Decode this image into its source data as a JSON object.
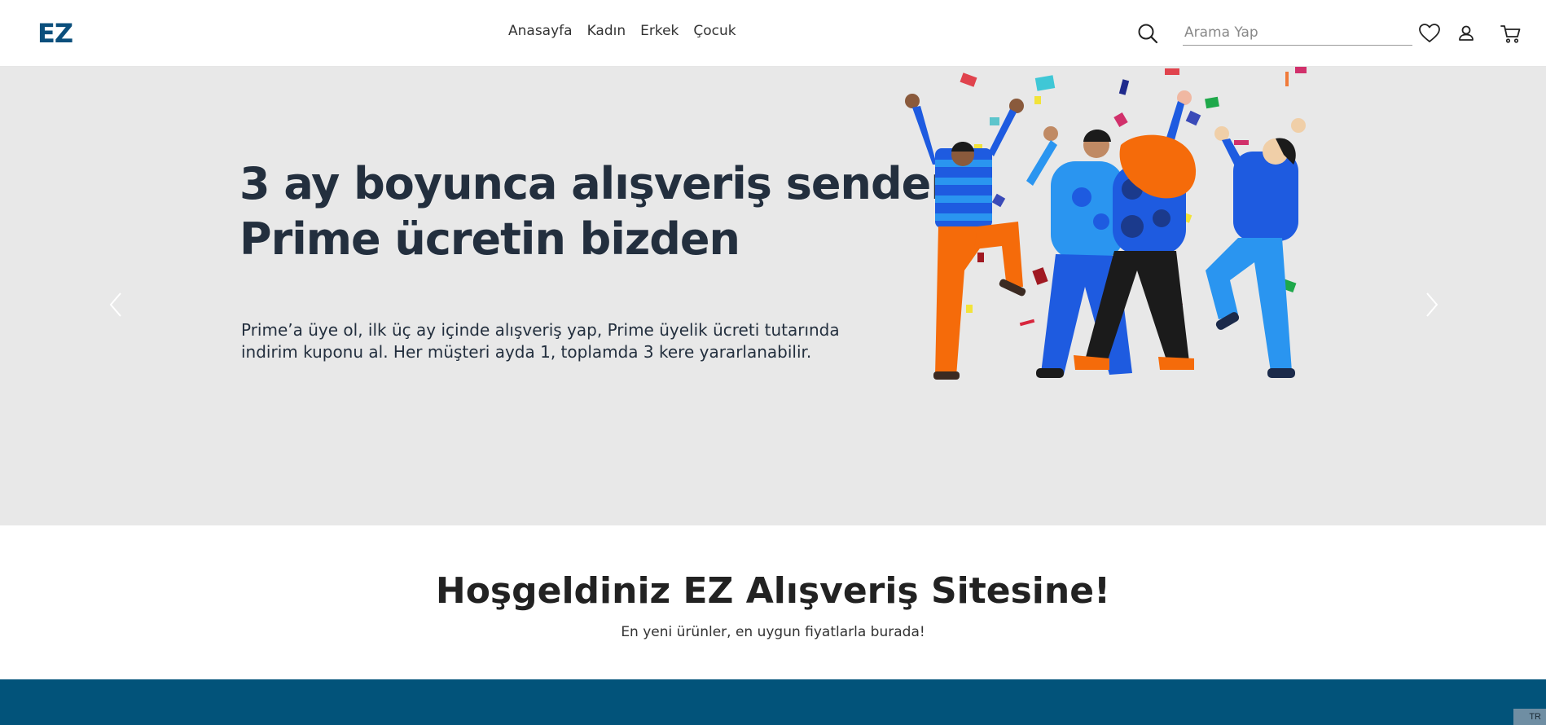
{
  "header": {
    "logo": "EZ",
    "nav": [
      "Anasayfa",
      "Kadın",
      "Erkek",
      "Çocuk"
    ],
    "search": {
      "placeholder": "Arama Yap",
      "value": ""
    },
    "icons": [
      "search-icon",
      "heart-icon",
      "user-icon",
      "cart-icon"
    ]
  },
  "hero": {
    "title_line1": "3 ay boyunca alışveriş senden,",
    "title_line2": "Prime ücretin bizden",
    "desc_line1": "Prime’a üye ol, ilk üç ay içinde alışveriş yap, Prime üyelik ücreti tutarında",
    "desc_line2": "indirim kuponu al. Her müşteri ayda 1, toplamda 3 kere yararlanabilir.",
    "icons": [
      "chevron-left-icon",
      "chevron-right-icon"
    ]
  },
  "welcome": {
    "title": "Hoşgeldiniz EZ Alışveriş Sitesine!",
    "subtitle": "En yeni ürünler, en uygun fiyatlarla burada!"
  },
  "footer": {
    "lang": "TR"
  },
  "colors": {
    "brand": "#0b4f7c",
    "band": "#02537a",
    "hero_bg": "#e8e8e8",
    "hero_text": "#232f3e"
  }
}
